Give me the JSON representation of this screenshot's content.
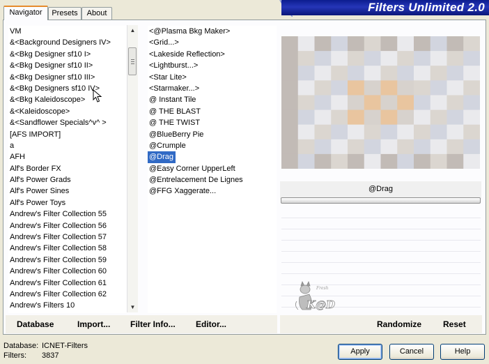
{
  "tabs": [
    {
      "label": "Navigator",
      "active": true
    },
    {
      "label": "Presets",
      "active": false
    },
    {
      "label": "About",
      "active": false
    }
  ],
  "banner_title": "Filters Unlimited 2.0",
  "categories": [
    "VM",
    "&<Background Designers IV>",
    "&<Bkg Designer sf10 I>",
    "&<Bkg Designer sf10 II>",
    "&<Bkg Designer sf10 III>",
    "&<Bkg Designers sf10 IV>",
    "&<Bkg Kaleidoscope>",
    "&<Kaleidoscope>",
    "&<Sandflower Specials^v^ >",
    "[AFS IMPORT]",
    "a",
    "AFH",
    "Alf's Border FX",
    "Alf's Power Grads",
    "Alf's Power Sines",
    "Alf's Power Toys",
    "Andrew's Filter Collection 55",
    "Andrew's Filter Collection 56",
    "Andrew's Filter Collection 57",
    "Andrew's Filter Collection 58",
    "Andrew's Filter Collection 59",
    "Andrew's Filter Collection 60",
    "Andrew's Filter Collection 61",
    "Andrew's Filter Collection 62",
    "Andrew's Filters 10"
  ],
  "filters": [
    "<@Plasma Bkg Maker>",
    "<Grid...>",
    "<Lakeside Reflection>",
    "<Lightburst...>",
    "<Star Lite>",
    "<Starmaker...>",
    "@ Instant Tile",
    "@ THE BLAST",
    "@ THE TWIST",
    "@BlueBerry Pie",
    "@Crumple",
    "@Drag",
    "@Easy Corner UpperLeft",
    "@Entrelacement De Lignes",
    "@FFG Xaggerate..."
  ],
  "selected_filter": "@Drag",
  "preview_label": "@Drag",
  "bottom_left": {
    "database": "Database",
    "import": "Import...",
    "filter_info": "Filter Info...",
    "editor": "Editor..."
  },
  "bottom_right": {
    "randomize": "Randomize",
    "reset": "Reset"
  },
  "status": {
    "database_label": "Database:",
    "database_value": "ICNET-Filters",
    "filters_label": "Filters:",
    "filters_value": "3837"
  },
  "dialog_buttons": {
    "apply": "Apply",
    "cancel": "Cancel",
    "help": "Help"
  },
  "watermark_text": "K@D",
  "colors": {
    "selection": "#316ac5",
    "banner": "#1a2aa8",
    "tab_accent": "#e68b2c"
  }
}
